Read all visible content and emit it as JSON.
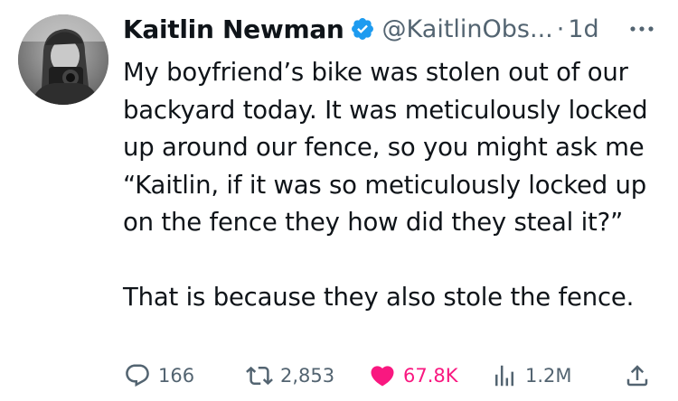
{
  "author": {
    "display_name": "Kaitlin Newman",
    "handle": "@KaitlinObs...",
    "separator": "·",
    "time": "1d",
    "verified": true,
    "verified_color": "#1d9bf0"
  },
  "tweet": {
    "paragraphs": [
      "My boyfriend’s bike was stolen out of our backyard today. It was meticulously locked up around our fence, so you might ask me “Kaitlin, if it was so meticulously locked up on the fence they how did they steal it?”",
      "That is because they also stole the fence."
    ]
  },
  "actions": {
    "replies": "166",
    "retweets": "2,853",
    "likes": "67.8K",
    "views": "1.2M",
    "liked": true,
    "like_color": "#f91880"
  },
  "icons": {
    "verified": "verified-badge-icon",
    "more": "more-options-icon",
    "reply": "reply-icon",
    "retweet": "retweet-icon",
    "like": "heart-icon",
    "views": "views-chart-icon",
    "share": "share-icon"
  }
}
